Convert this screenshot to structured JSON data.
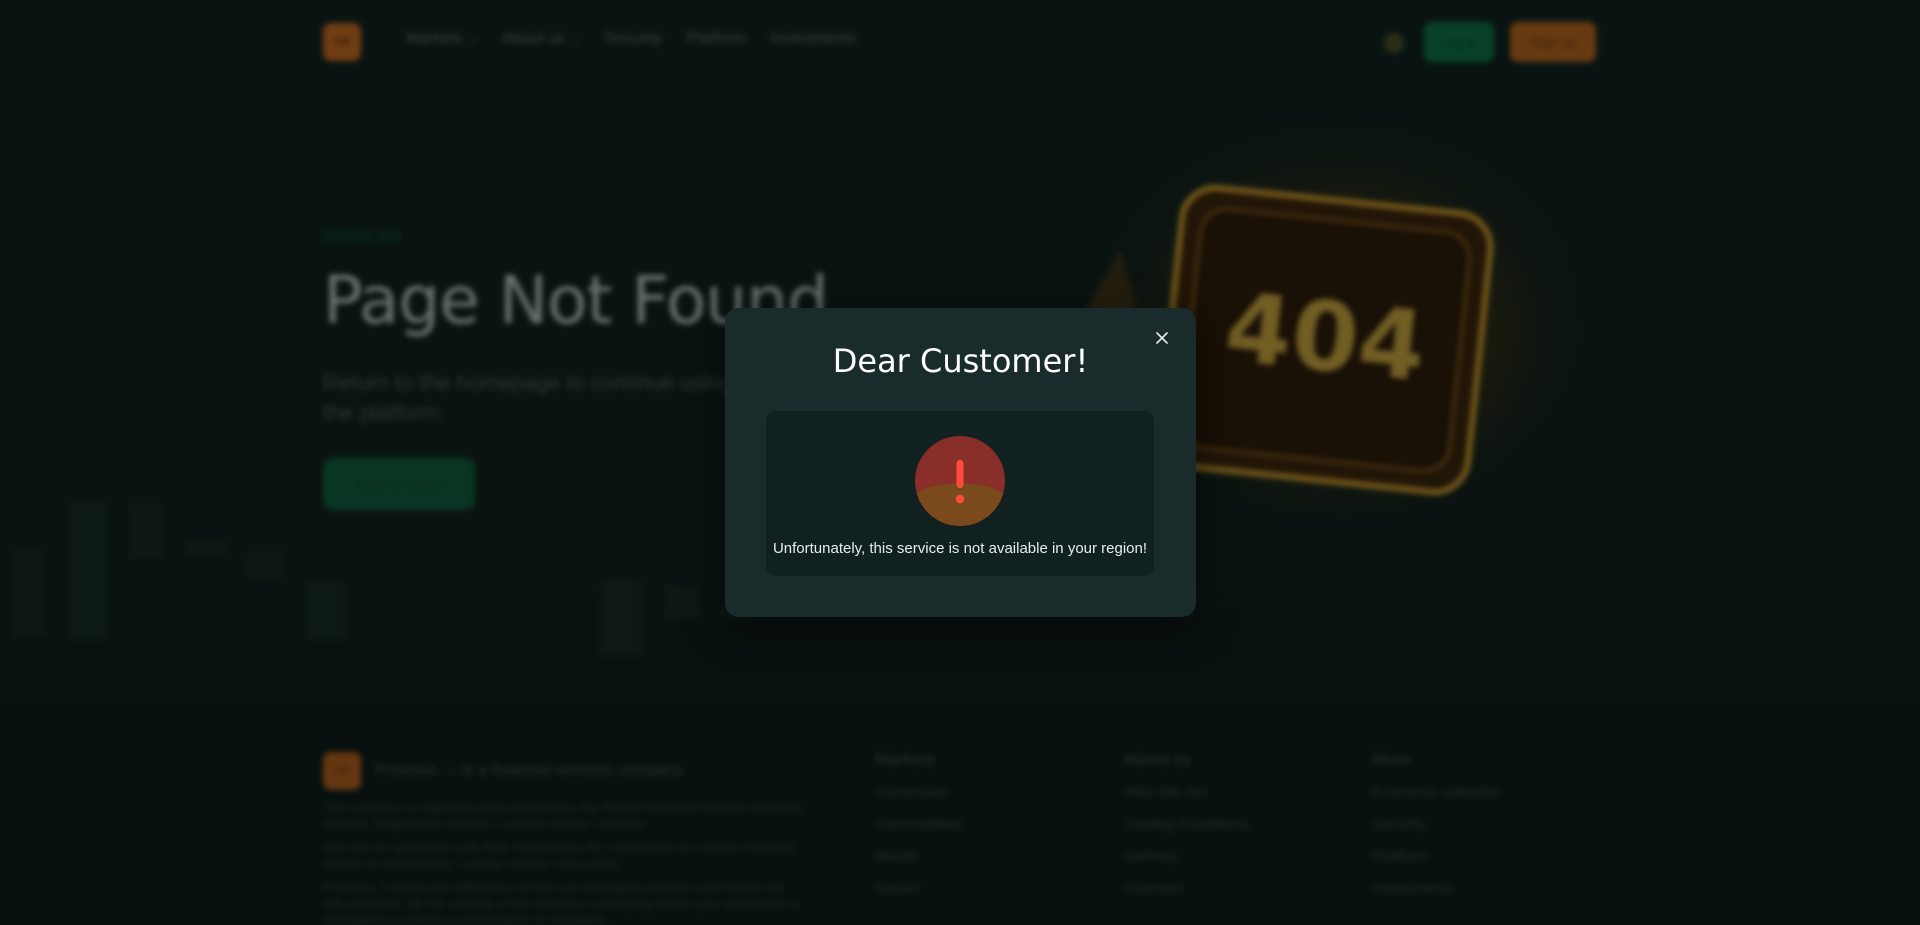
{
  "background": {
    "header": {
      "logo_text": "AB",
      "nav": [
        {
          "label": "Markets",
          "has_dropdown": true
        },
        {
          "label": "About us",
          "has_dropdown": true
        },
        {
          "label": "Security",
          "has_dropdown": false
        },
        {
          "label": "Platform",
          "has_dropdown": false
        },
        {
          "label": "Investments",
          "has_dropdown": false
        }
      ],
      "login_label": "Log in",
      "signup_label": "Sign up"
    },
    "hero": {
      "tag": "ERROR 404",
      "title": "Page Not Found",
      "subtitle": "Return to the homepage to continue using the platform.",
      "button_label": "Back to Home"
    },
    "illustration_text": "404",
    "footer": {
      "logo_text": "AB",
      "tagline": "Providus — is a financial services company",
      "legal": [
        "The company is registered and regulated by the Global Financial Services Authority (GFSA). Registration number: License number: Address:",
        "Also has its operations with Risk Governance for Compliance on Certain Financial modes of underwriting. License number: Also entity.",
        "Providus, Contract for Difference (CFDs) are leveraged products and involve the risk exposure. All risk capable of the market or underlying where your derivatives is not traded on primary in accordance to regulation."
      ],
      "columns": [
        {
          "heading": "Markets",
          "links": [
            "Currencies",
            "Commodities",
            "Metals",
            "Stocks"
          ]
        },
        {
          "heading": "About us",
          "links": [
            "Who We Are",
            "Trading Conditions",
            "Delivery",
            "Licenses"
          ]
        },
        {
          "heading": "More",
          "links": [
            "Economic calendar",
            "Security",
            "Platform",
            "Investments"
          ]
        }
      ]
    }
  },
  "modal": {
    "title": "Dear Customer!",
    "message": "Unfortunately, this service is not available in your region!",
    "close_icon": "close-icon",
    "alert_icon": "exclamation-icon"
  },
  "colors": {
    "modal_bg": "#192b2a",
    "modal_inner_bg": "#112120",
    "alert_top": "#8a2e2a",
    "alert_bottom": "#7a4a1c",
    "alert_mark": "#ff4b3a",
    "brand_green": "#0b6e42",
    "brand_orange": "#c8661c"
  }
}
